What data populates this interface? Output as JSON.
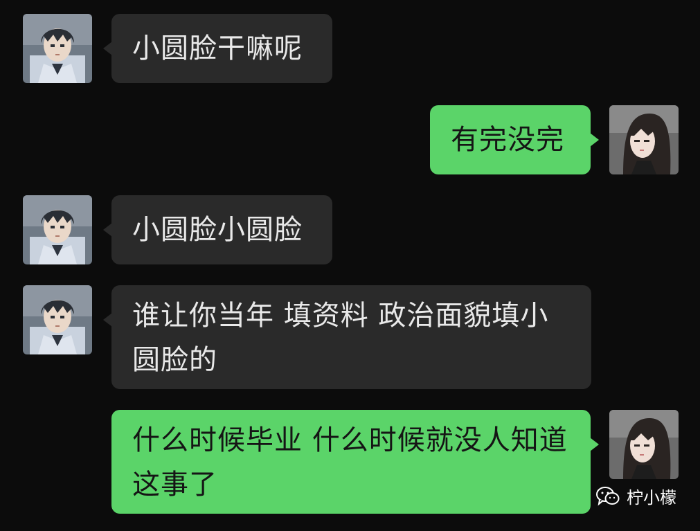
{
  "messages": [
    {
      "side": "in",
      "text": "小圆脸干嘛呢"
    },
    {
      "side": "out",
      "text": "有完没完"
    },
    {
      "side": "in",
      "text": "小圆脸小圆脸"
    },
    {
      "side": "in",
      "text": "谁让你当年  填资料  政治面貌填小圆脸的"
    },
    {
      "side": "out",
      "text": "什么时候毕业  什么时候就没人知道这事了"
    }
  ],
  "watermark": {
    "text": "柠小檬",
    "icon": "wechat-icon"
  },
  "colors": {
    "background": "#0c0c0c",
    "incoming_bubble": "#2a2a2a",
    "outgoing_bubble": "#5bd469"
  }
}
